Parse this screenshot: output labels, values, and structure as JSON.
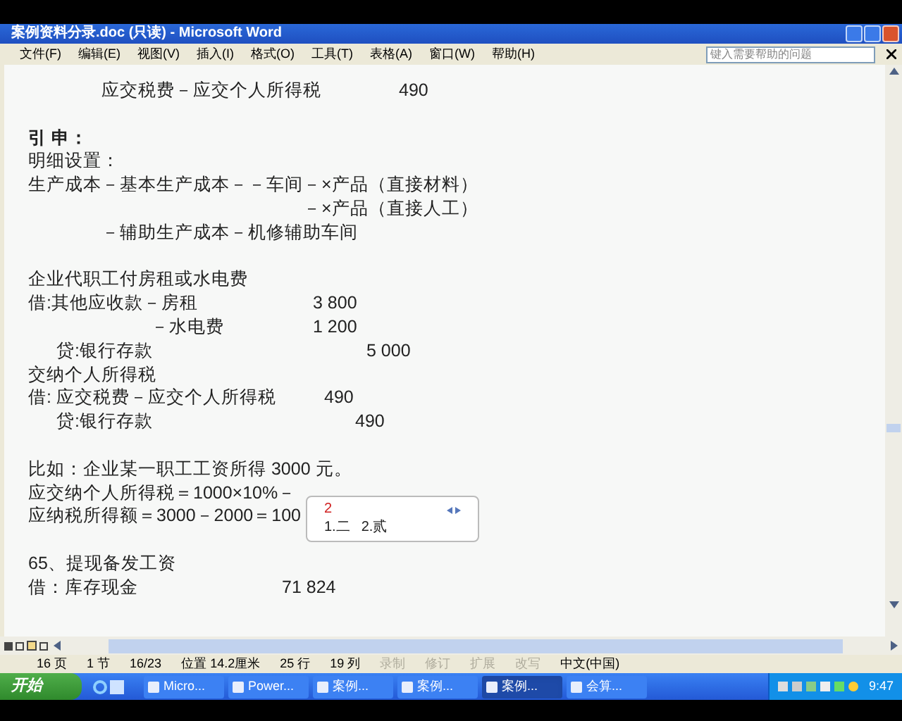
{
  "window": {
    "title": "案例资料分录.doc (只读) - Microsoft Word"
  },
  "menu": [
    {
      "label": "文件(F)"
    },
    {
      "label": "编辑(E)"
    },
    {
      "label": "视图(V)"
    },
    {
      "label": "插入(I)"
    },
    {
      "label": "格式(O)"
    },
    {
      "label": "工具(T)"
    },
    {
      "label": "表格(A)"
    },
    {
      "label": "窗口(W)"
    },
    {
      "label": "帮助(H)"
    }
  ],
  "help_search": {
    "placeholder": "键入需要帮助的问题"
  },
  "document": {
    "lines": [
      {
        "text": "应交税费－应交个人所得税",
        "amount": "490",
        "bold": false
      },
      {
        "text": "引 申：",
        "bold": true
      },
      {
        "text": "明细设置：",
        "bold": false
      },
      {
        "text": "生产成本－基本生产成本－－车间－×产品（直接材料）",
        "bold": false
      },
      {
        "text": "－×产品（直接人工）",
        "bold": false
      },
      {
        "text": "－辅助生产成本－机修辅助车间",
        "bold": false
      },
      {
        "text": "企业代职工付房租或水电费",
        "bold": false
      },
      {
        "text": "借:其他应收款－房租",
        "amount": "3 800",
        "bold": false
      },
      {
        "text": "－水电费",
        "amount": "1 200",
        "bold": false
      },
      {
        "text": "贷:银行存款",
        "amount": "5 000",
        "bold": false
      },
      {
        "text": "交纳个人所得税",
        "bold": false
      },
      {
        "text": "借:  应交税费－应交个人所得税",
        "amount": "490",
        "bold": false
      },
      {
        "text": "贷:银行存款",
        "amount": "490",
        "bold": false
      },
      {
        "text": "比如：企业某一职工工资所得 3000 元。",
        "bold": false
      },
      {
        "text": "应交纳个人所得税＝1000×10%－",
        "bold": false
      },
      {
        "text": "应纳税所得额＝3000－2000＝100",
        "bold": false
      },
      {
        "text": "65、提现备发工资",
        "bold": false
      },
      {
        "text": "借：库存现金",
        "amount": "71 824",
        "bold": false
      }
    ]
  },
  "ime_popup": {
    "composition": "2",
    "candidates": [
      "1.二",
      "2.贰"
    ]
  },
  "status_bar": [
    {
      "text": "16 页",
      "disabled": false
    },
    {
      "text": "1 节",
      "disabled": false
    },
    {
      "text": "16/23",
      "disabled": false
    },
    {
      "text": "位置 14.2厘米",
      "disabled": false
    },
    {
      "text": "25 行",
      "disabled": false
    },
    {
      "text": "19 列",
      "disabled": false
    },
    {
      "text": "录制",
      "disabled": true
    },
    {
      "text": "修订",
      "disabled": true
    },
    {
      "text": "扩展",
      "disabled": true
    },
    {
      "text": "改写",
      "disabled": true
    },
    {
      "text": "中文(中国)",
      "disabled": false
    }
  ],
  "taskbar": {
    "start": "开始",
    "tasks": [
      {
        "label": "Micro...",
        "selected": false
      },
      {
        "label": "Power...",
        "selected": false
      },
      {
        "label": "案例...",
        "selected": false
      },
      {
        "label": "案例...",
        "selected": false
      },
      {
        "label": "案例...",
        "selected": true
      },
      {
        "label": "会算...",
        "selected": false
      }
    ],
    "clock": "9:47"
  }
}
